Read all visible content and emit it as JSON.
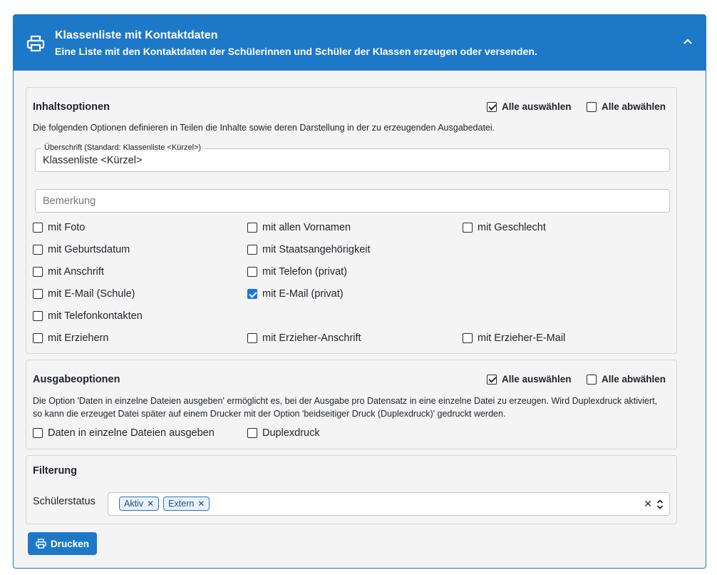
{
  "header": {
    "title": "Klassenliste mit Kontaktdaten",
    "subtitle": "Eine Liste mit den Kontaktdaten der Schülerinnen und Schüler der Klassen erzeugen oder versenden.",
    "icon": "printer-icon",
    "collapse_icon": "chevron-up-icon",
    "color": "#1e78c8"
  },
  "inhalt": {
    "title": "Inhaltsoptionen",
    "select_all": "Alle auswählen",
    "deselect_all": "Alle abwählen",
    "description": "Die folgenden Optionen definieren in Teilen die Inhalte sowie deren Darstellung in der zu erzeugenden Ausgabedatei.",
    "heading_label": "Überschrift (Standard: Klassenliste <Kürzel>)",
    "heading_value": "Klassenliste <Kürzel>",
    "remark_placeholder": "Bemerkung",
    "options": {
      "foto": {
        "label": "mit Foto",
        "checked": false
      },
      "vornamen": {
        "label": "mit allen Vornamen",
        "checked": false
      },
      "geschlecht": {
        "label": "mit Geschlecht",
        "checked": false
      },
      "geburtsdatum": {
        "label": "mit Geburtsdatum",
        "checked": false
      },
      "staatsangehoerigkeit": {
        "label": "mit Staatsangehörigkeit",
        "checked": false
      },
      "anschrift": {
        "label": "mit Anschrift",
        "checked": false
      },
      "telefon_privat": {
        "label": "mit Telefon (privat)",
        "checked": false
      },
      "email_schule": {
        "label": "mit E-Mail (Schule)",
        "checked": false
      },
      "email_privat": {
        "label": "mit E-Mail (privat)",
        "checked": true
      },
      "telefonkontakte": {
        "label": "mit Telefonkontakten",
        "checked": false
      },
      "erzieher": {
        "label": "mit Erziehern",
        "checked": false
      },
      "erzieher_anschrift": {
        "label": "mit Erzieher-Anschrift",
        "checked": false
      },
      "erzieher_email": {
        "label": "mit Erzieher-E-Mail",
        "checked": false
      }
    }
  },
  "ausgabe": {
    "title": "Ausgabeoptionen",
    "select_all": "Alle auswählen",
    "deselect_all": "Alle abwählen",
    "description": "Die Option 'Daten in einzelne Dateien ausgeben' ermöglicht es, bei der Ausgabe pro Datensatz in eine einzelne Datei zu erzeugen. Wird Duplexdruck aktiviert, so kann die erzeuget Datei später auf einem Drucker mit der Option 'beidseitiger Druck (Duplexdruck)' gedruckt werden.",
    "options": {
      "einzelne_dateien": {
        "label": "Daten in einzelne Dateien ausgeben",
        "checked": false
      },
      "duplex": {
        "label": "Duplexdruck",
        "checked": false
      }
    }
  },
  "filter": {
    "title": "Filterung",
    "status_label": "Schülerstatus",
    "tags": [
      "Aktiv",
      "Extern"
    ],
    "clear_icon": "clear-icon",
    "toggle_icon": "updown-icon"
  },
  "print_button": "Drucken"
}
